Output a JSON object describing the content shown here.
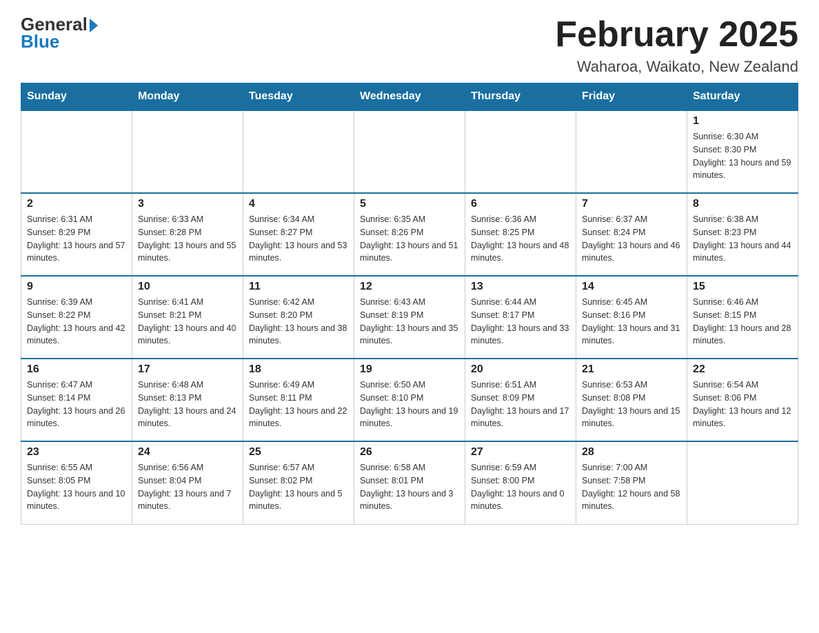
{
  "header": {
    "logo_general": "General",
    "logo_blue": "Blue",
    "title": "February 2025",
    "subtitle": "Waharoa, Waikato, New Zealand"
  },
  "days_of_week": [
    "Sunday",
    "Monday",
    "Tuesday",
    "Wednesday",
    "Thursday",
    "Friday",
    "Saturday"
  ],
  "weeks": [
    [
      {
        "day": "",
        "info": ""
      },
      {
        "day": "",
        "info": ""
      },
      {
        "day": "",
        "info": ""
      },
      {
        "day": "",
        "info": ""
      },
      {
        "day": "",
        "info": ""
      },
      {
        "day": "",
        "info": ""
      },
      {
        "day": "1",
        "info": "Sunrise: 6:30 AM\nSunset: 8:30 PM\nDaylight: 13 hours and 59 minutes."
      }
    ],
    [
      {
        "day": "2",
        "info": "Sunrise: 6:31 AM\nSunset: 8:29 PM\nDaylight: 13 hours and 57 minutes."
      },
      {
        "day": "3",
        "info": "Sunrise: 6:33 AM\nSunset: 8:28 PM\nDaylight: 13 hours and 55 minutes."
      },
      {
        "day": "4",
        "info": "Sunrise: 6:34 AM\nSunset: 8:27 PM\nDaylight: 13 hours and 53 minutes."
      },
      {
        "day": "5",
        "info": "Sunrise: 6:35 AM\nSunset: 8:26 PM\nDaylight: 13 hours and 51 minutes."
      },
      {
        "day": "6",
        "info": "Sunrise: 6:36 AM\nSunset: 8:25 PM\nDaylight: 13 hours and 48 minutes."
      },
      {
        "day": "7",
        "info": "Sunrise: 6:37 AM\nSunset: 8:24 PM\nDaylight: 13 hours and 46 minutes."
      },
      {
        "day": "8",
        "info": "Sunrise: 6:38 AM\nSunset: 8:23 PM\nDaylight: 13 hours and 44 minutes."
      }
    ],
    [
      {
        "day": "9",
        "info": "Sunrise: 6:39 AM\nSunset: 8:22 PM\nDaylight: 13 hours and 42 minutes."
      },
      {
        "day": "10",
        "info": "Sunrise: 6:41 AM\nSunset: 8:21 PM\nDaylight: 13 hours and 40 minutes."
      },
      {
        "day": "11",
        "info": "Sunrise: 6:42 AM\nSunset: 8:20 PM\nDaylight: 13 hours and 38 minutes."
      },
      {
        "day": "12",
        "info": "Sunrise: 6:43 AM\nSunset: 8:19 PM\nDaylight: 13 hours and 35 minutes."
      },
      {
        "day": "13",
        "info": "Sunrise: 6:44 AM\nSunset: 8:17 PM\nDaylight: 13 hours and 33 minutes."
      },
      {
        "day": "14",
        "info": "Sunrise: 6:45 AM\nSunset: 8:16 PM\nDaylight: 13 hours and 31 minutes."
      },
      {
        "day": "15",
        "info": "Sunrise: 6:46 AM\nSunset: 8:15 PM\nDaylight: 13 hours and 28 minutes."
      }
    ],
    [
      {
        "day": "16",
        "info": "Sunrise: 6:47 AM\nSunset: 8:14 PM\nDaylight: 13 hours and 26 minutes."
      },
      {
        "day": "17",
        "info": "Sunrise: 6:48 AM\nSunset: 8:13 PM\nDaylight: 13 hours and 24 minutes."
      },
      {
        "day": "18",
        "info": "Sunrise: 6:49 AM\nSunset: 8:11 PM\nDaylight: 13 hours and 22 minutes."
      },
      {
        "day": "19",
        "info": "Sunrise: 6:50 AM\nSunset: 8:10 PM\nDaylight: 13 hours and 19 minutes."
      },
      {
        "day": "20",
        "info": "Sunrise: 6:51 AM\nSunset: 8:09 PM\nDaylight: 13 hours and 17 minutes."
      },
      {
        "day": "21",
        "info": "Sunrise: 6:53 AM\nSunset: 8:08 PM\nDaylight: 13 hours and 15 minutes."
      },
      {
        "day": "22",
        "info": "Sunrise: 6:54 AM\nSunset: 8:06 PM\nDaylight: 13 hours and 12 minutes."
      }
    ],
    [
      {
        "day": "23",
        "info": "Sunrise: 6:55 AM\nSunset: 8:05 PM\nDaylight: 13 hours and 10 minutes."
      },
      {
        "day": "24",
        "info": "Sunrise: 6:56 AM\nSunset: 8:04 PM\nDaylight: 13 hours and 7 minutes."
      },
      {
        "day": "25",
        "info": "Sunrise: 6:57 AM\nSunset: 8:02 PM\nDaylight: 13 hours and 5 minutes."
      },
      {
        "day": "26",
        "info": "Sunrise: 6:58 AM\nSunset: 8:01 PM\nDaylight: 13 hours and 3 minutes."
      },
      {
        "day": "27",
        "info": "Sunrise: 6:59 AM\nSunset: 8:00 PM\nDaylight: 13 hours and 0 minutes."
      },
      {
        "day": "28",
        "info": "Sunrise: 7:00 AM\nSunset: 7:58 PM\nDaylight: 12 hours and 58 minutes."
      },
      {
        "day": "",
        "info": ""
      }
    ]
  ]
}
